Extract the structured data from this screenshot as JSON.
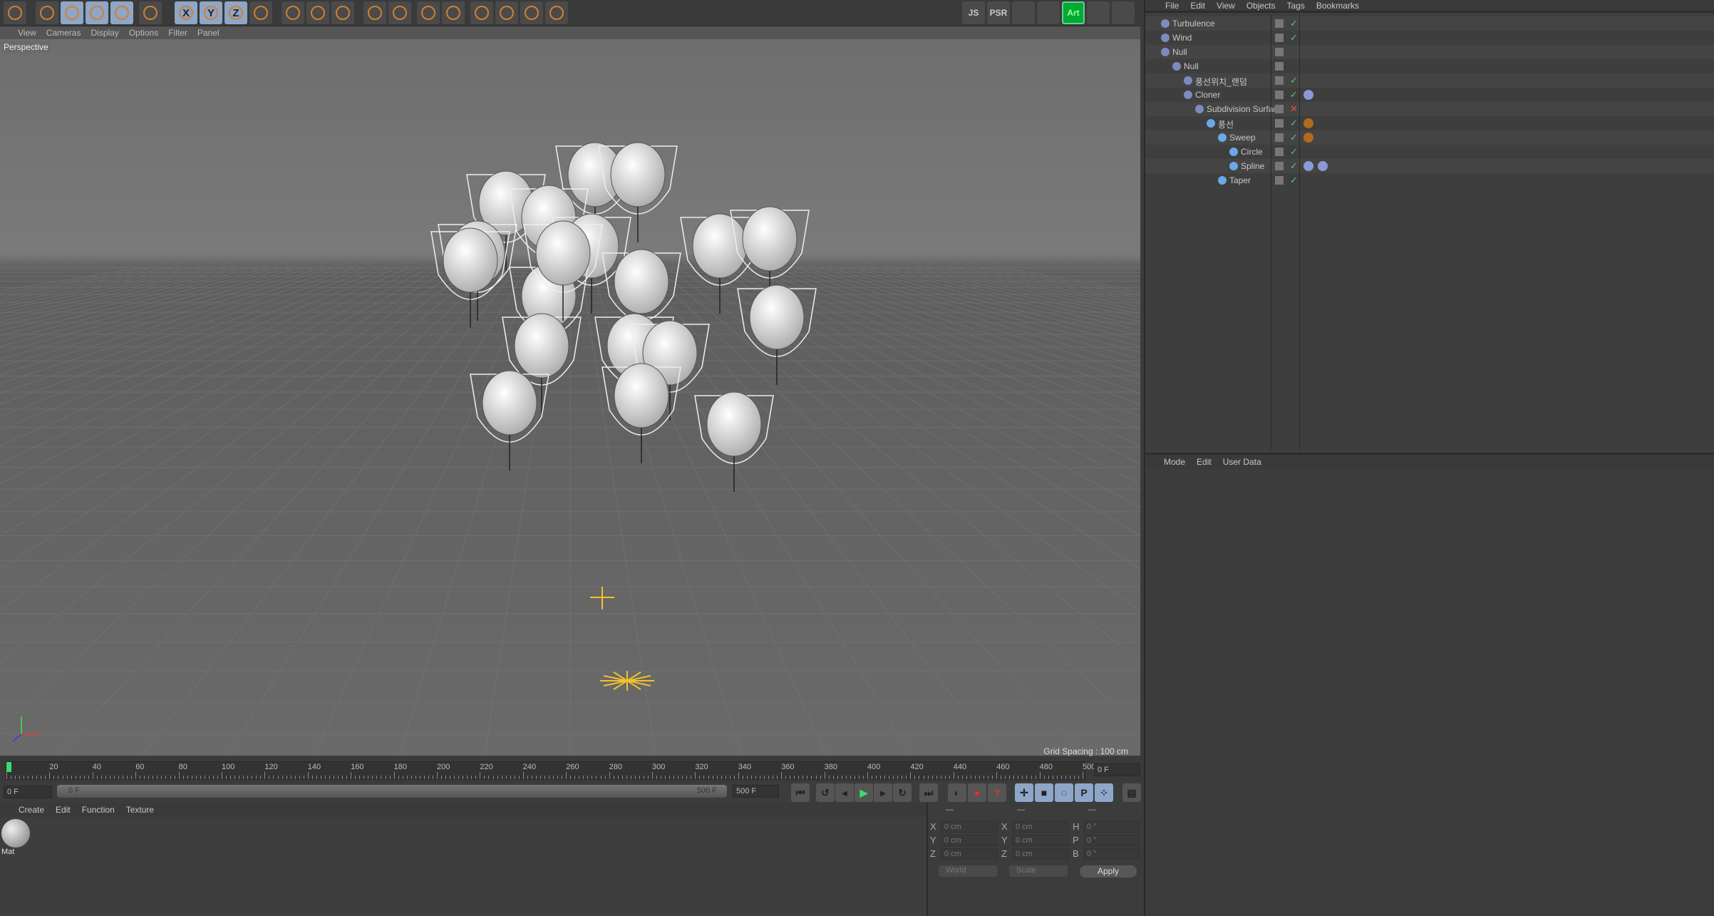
{
  "toolbar": {
    "icons": [
      "undo-icon",
      "select-icon",
      "move-icon",
      "scale-icon",
      "rotate-icon",
      "live-select-icon",
      "x-axis-icon",
      "y-axis-icon",
      "z-axis-icon",
      "coordinate-system-icon",
      "render-view-icon",
      "render-picture-viewer-icon",
      "render-settings-icon",
      "cube-icon",
      "pen-icon",
      "subdivision-icon",
      "cloner-icon",
      "deformer-flag-icon",
      "floor-icon",
      "camera-icon",
      "light-icon"
    ],
    "x_label": "X",
    "y_label": "Y",
    "z_label": "Z",
    "right_icons": [
      "js-help-icon",
      "psr-icon",
      "layout-icon",
      "paint-icon",
      "art-icon",
      "align-icon",
      "tools-icon"
    ],
    "psr_label": "PSR",
    "art_label": "Art",
    "js_label": "JS"
  },
  "viewport": {
    "menu": [
      "View",
      "Cameras",
      "Display",
      "Options",
      "Filter",
      "Panel"
    ],
    "camera": "Perspective",
    "grid_spacing": "Grid Spacing : 100 cm"
  },
  "object_manager": {
    "menu": [
      "File",
      "Edit",
      "View",
      "Objects",
      "Tags",
      "Bookmarks"
    ],
    "objects": [
      {
        "name": "Turbulence",
        "depth": 0,
        "icon": "turbulence-icon",
        "status": "check"
      },
      {
        "name": "Wind",
        "depth": 0,
        "icon": "wind-icon",
        "status": "check"
      },
      {
        "name": "Null",
        "depth": 0,
        "icon": "null-icon",
        "status": "none"
      },
      {
        "name": "Null",
        "depth": 1,
        "icon": "null-icon",
        "status": "none"
      },
      {
        "name": "풍선위치_랜덤",
        "depth": 2,
        "icon": "random-effector-icon",
        "status": "check"
      },
      {
        "name": "Cloner",
        "depth": 2,
        "icon": "cloner-icon",
        "status": "check",
        "tags": [
          "mograph-tag-icon"
        ]
      },
      {
        "name": "Subdivision Surfac",
        "depth": 3,
        "icon": "subdivision-icon",
        "status": "cross"
      },
      {
        "name": "풍선",
        "depth": 4,
        "icon": "sphere-icon",
        "status": "check",
        "tags": [
          "material-tag-icon"
        ]
      },
      {
        "name": "Sweep",
        "depth": 5,
        "icon": "sweep-icon",
        "status": "check",
        "tags": [
          "material-tag-icon"
        ]
      },
      {
        "name": "Circle",
        "depth": 6,
        "icon": "circle-icon",
        "status": "check"
      },
      {
        "name": "Spline",
        "depth": 6,
        "icon": "spline-icon",
        "status": "check",
        "tags": [
          "dynamics-tag-icon",
          "spline-tag-icon"
        ]
      },
      {
        "name": "Taper",
        "depth": 5,
        "icon": "taper-icon",
        "status": "check"
      }
    ]
  },
  "attributes": {
    "menu": [
      "Mode",
      "Edit",
      "User Data"
    ]
  },
  "timeline": {
    "ticks": [
      "0",
      "20",
      "40",
      "60",
      "80",
      "100",
      "120",
      "140",
      "160",
      "180",
      "200",
      "220",
      "240",
      "260",
      "280",
      "300",
      "320",
      "340",
      "360",
      "380",
      "400",
      "420",
      "440",
      "460",
      "480",
      "500"
    ],
    "current_frame": "0 F",
    "start_field": "0 F",
    "range_start": "0 F",
    "range_end": "500 F",
    "end_field": "500 F",
    "playhead_frame": 0
  },
  "materials": {
    "menu": [
      "Create",
      "Edit",
      "Function",
      "Texture"
    ],
    "items": [
      {
        "name": "Mat"
      }
    ]
  },
  "coordinates": {
    "headers": [
      "—",
      "—",
      "—"
    ],
    "position": [
      {
        "axis": "X",
        "value": "0 cm"
      },
      {
        "axis": "Y",
        "value": "0 cm"
      },
      {
        "axis": "Z",
        "value": "0 cm"
      }
    ],
    "size": [
      {
        "axis": "X",
        "value": "0 cm"
      },
      {
        "axis": "Y",
        "value": "0 cm"
      },
      {
        "axis": "Z",
        "value": "0 cm"
      }
    ],
    "rotation": [
      {
        "axis": "H",
        "value": "0 °"
      },
      {
        "axis": "P",
        "value": "0 °"
      },
      {
        "axis": "B",
        "value": "0 °"
      }
    ],
    "mode_select": "World",
    "size_select": "Scale",
    "apply_label": "Apply"
  },
  "colors": {
    "accent": "#8ea6c8",
    "check": "#5ec26a",
    "cross": "#d9534f",
    "playhead": "#3ddc6e",
    "highlight": "#f2c12e"
  }
}
